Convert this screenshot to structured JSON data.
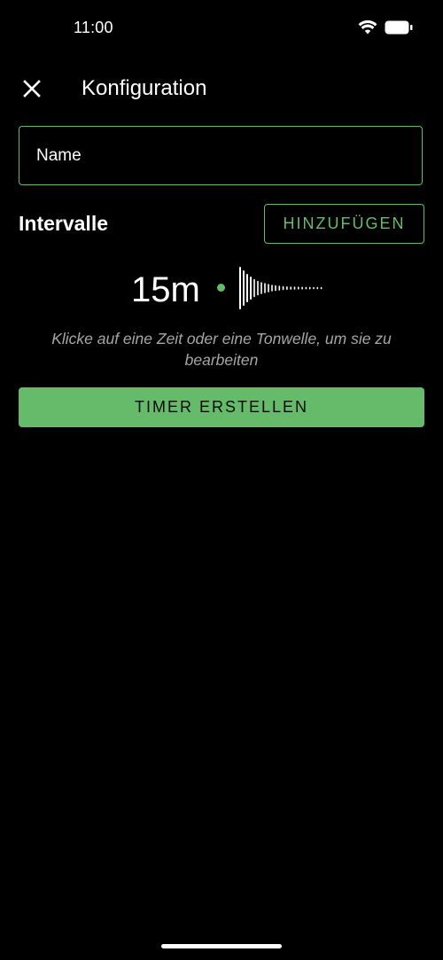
{
  "status_bar": {
    "time": "11:00",
    "icons": [
      "wifi-icon",
      "battery-icon"
    ]
  },
  "app_bar": {
    "close_icon": "close-icon",
    "title": "Konfiguration"
  },
  "name_field": {
    "placeholder": "Name",
    "value": ""
  },
  "intervals": {
    "heading": "Intervalle",
    "add_label": "HINZUFÜGEN",
    "items": [
      {
        "time": "15m",
        "sound_icon": "sound-wave-icon"
      }
    ],
    "hint": "Klicke auf eine Zeit oder eine Tonwelle, um sie zu bearbeiten"
  },
  "create_button": {
    "label": "TIMER ERSTELLEN"
  },
  "colors": {
    "accent": "#66bb6a",
    "background": "#000000",
    "hint_text": "#a6a6a6"
  }
}
